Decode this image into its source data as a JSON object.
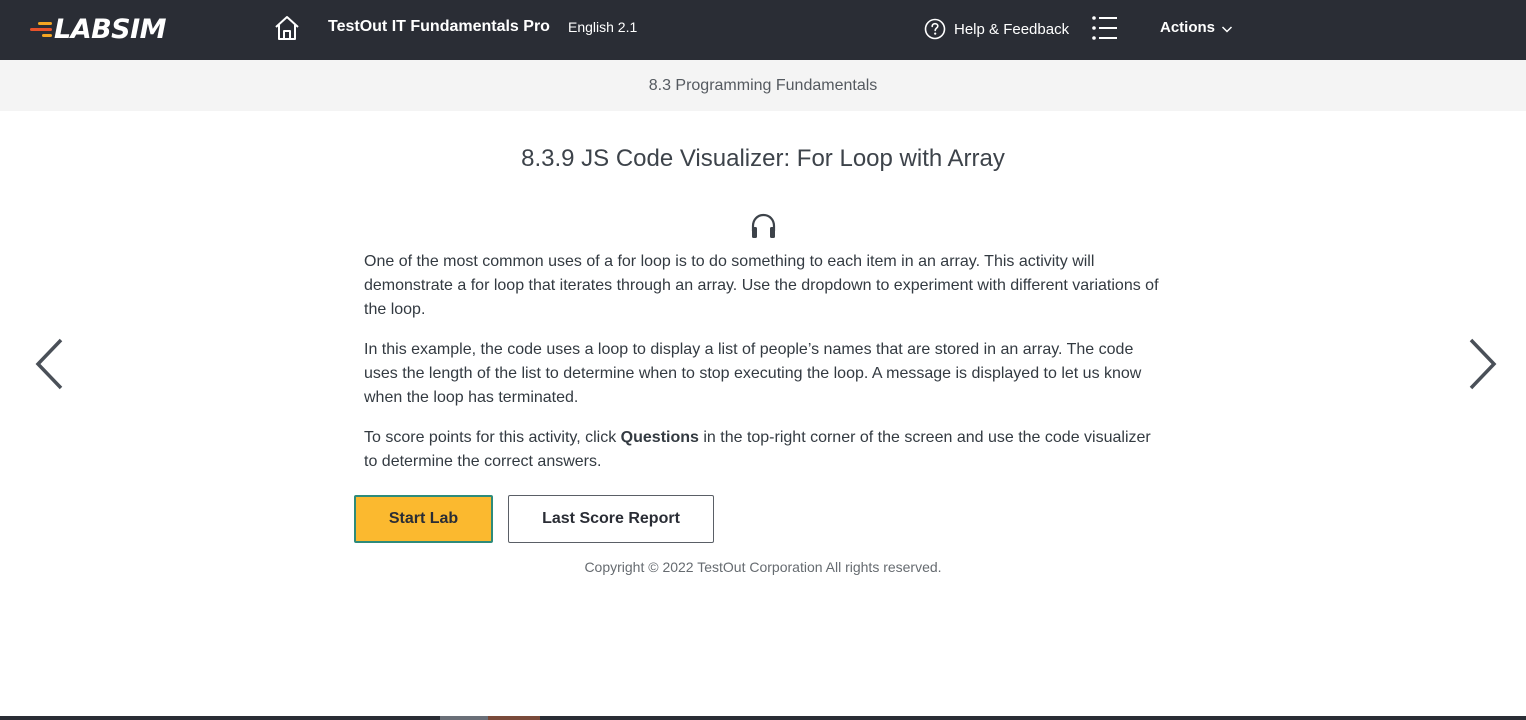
{
  "header": {
    "logo_text": "LABSIM",
    "course_title": "TestOut IT Fundamentals Pro",
    "course_version": "English 2.1",
    "help_label": "Help & Feedback",
    "actions_label": "Actions"
  },
  "breadcrumb": {
    "section": "8.3 Programming Fundamentals"
  },
  "main": {
    "title": "8.3.9 JS Code Visualizer: For Loop with Array",
    "paragraph1": "One of the most common uses of a for loop is to do something to each item in an array. This activity will demonstrate a for loop that iterates through an array. Use the dropdown to experiment with different variations of the loop.",
    "paragraph2": "In this example, the code uses a loop to display a list of people’s names that are stored in an array. The code uses the length of the list to determine when to stop executing the loop. A message is displayed to let us know when the loop has terminated.",
    "paragraph3_before": "To score points for this activity, click ",
    "paragraph3_bold": "Questions",
    "paragraph3_after": " in the top-right corner of the screen and use the code visualizer to determine the correct answers.",
    "start_button": "Start Lab",
    "report_button": "Last Score Report",
    "copyright": "Copyright © 2022 TestOut Corporation  All rights reserved."
  },
  "icons": {
    "home": "home-icon",
    "help": "question-circle-icon",
    "list": "list-icon",
    "chevron": "chevron-down-icon",
    "audio": "headphones-icon",
    "prev": "chevron-left-icon",
    "next": "chevron-right-icon"
  },
  "colors": {
    "topbar": "#2a2d35",
    "accent_button": "#fbb92f",
    "logo_orange": "#f5a623",
    "logo_red": "#e8532b"
  }
}
